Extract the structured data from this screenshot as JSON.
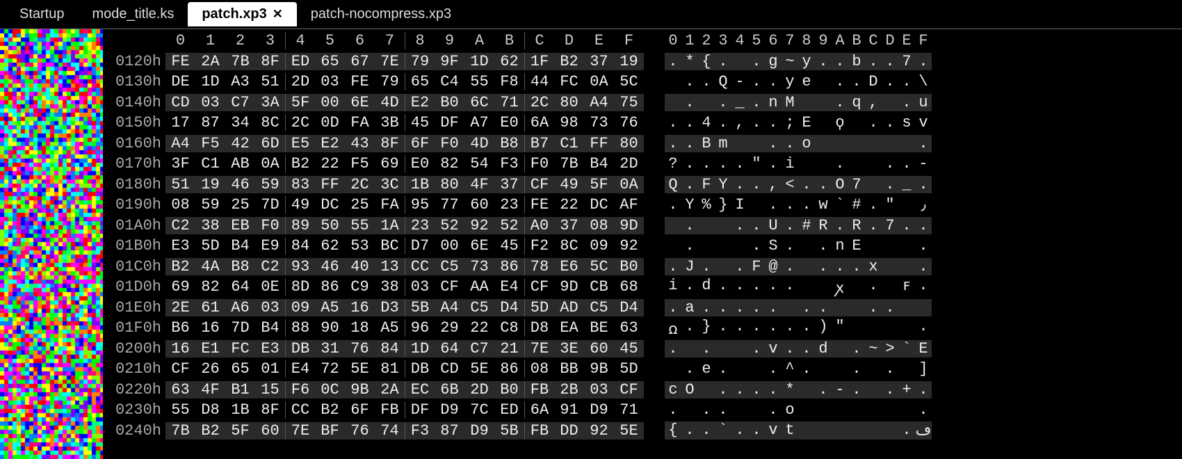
{
  "tabs": [
    {
      "label": "Startup",
      "active": false,
      "closable": false
    },
    {
      "label": "mode_title.ks",
      "active": false,
      "closable": false
    },
    {
      "label": "patch.xp3",
      "active": true,
      "closable": true
    },
    {
      "label": "patch-nocompress.xp3",
      "active": false,
      "closable": false
    }
  ],
  "hex_header": [
    "0",
    "1",
    "2",
    "3",
    "4",
    "5",
    "6",
    "7",
    "8",
    "9",
    "A",
    "B",
    "C",
    "D",
    "E",
    "F"
  ],
  "ascii_header": [
    "0",
    "1",
    "2",
    "3",
    "4",
    "5",
    "6",
    "7",
    "8",
    "9",
    "A",
    "B",
    "C",
    "D",
    "E",
    "F"
  ],
  "rows": [
    {
      "addr": "0120h",
      "hex": [
        "FE",
        "2A",
        "7B",
        "8F",
        "ED",
        "65",
        "67",
        "7E",
        "79",
        "9F",
        "1D",
        "62",
        "1F",
        "B2",
        "37",
        "19"
      ],
      "ascii": [
        ".",
        "*",
        "{",
        ".",
        " ",
        ".",
        "g",
        "~",
        "y",
        ".",
        ".",
        "b",
        ".",
        ".",
        "7",
        "."
      ]
    },
    {
      "addr": "0130h",
      "hex": [
        "DE",
        "1D",
        "A3",
        "51",
        "2D",
        "03",
        "FE",
        "79",
        "65",
        "C4",
        "55",
        "F8",
        "44",
        "FC",
        "0A",
        "5C"
      ],
      "ascii": [
        " ",
        ".",
        ".",
        "Q",
        "-",
        ".",
        ".",
        "y",
        "e",
        " ",
        ".",
        ".",
        "D",
        ".",
        ".",
        "\\"
      ]
    },
    {
      "addr": "0140h",
      "hex": [
        "CD",
        "03",
        "C7",
        "3A",
        "5F",
        "00",
        "6E",
        "4D",
        "E2",
        "B0",
        "6C",
        "71",
        "2C",
        "80",
        "A4",
        "75"
      ],
      "ascii": [
        " ",
        ".",
        " ",
        ".",
        "_",
        ".",
        "n",
        "M",
        " ",
        " ",
        ".",
        "q",
        ",",
        " ",
        ".",
        "u"
      ]
    },
    {
      "addr": "0150h",
      "hex": [
        "17",
        "87",
        "34",
        "8C",
        "2C",
        "0D",
        "FA",
        "3B",
        "45",
        "DF",
        "A7",
        "E0",
        "6A",
        "98",
        "73",
        "76"
      ],
      "ascii": [
        ".",
        ".",
        "4",
        ".",
        ",",
        ".",
        ".",
        ";",
        "E",
        " ",
        "ϙ",
        " ",
        ".",
        ".",
        "s",
        "v"
      ]
    },
    {
      "addr": "0160h",
      "hex": [
        "A4",
        "F5",
        "42",
        "6D",
        "E5",
        "E2",
        "43",
        "8F",
        "6F",
        "F0",
        "4D",
        "B8",
        "B7",
        "C1",
        "FF",
        "80"
      ],
      "ascii": [
        ".",
        ".",
        "B",
        "m",
        " ",
        " ",
        ".",
        ".",
        "o",
        " ",
        " ",
        " ",
        " ",
        " ",
        " ",
        "."
      ]
    },
    {
      "addr": "0170h",
      "hex": [
        "3F",
        "C1",
        "AB",
        "0A",
        "B2",
        "22",
        "F5",
        "69",
        "E0",
        "82",
        "54",
        "F3",
        "F0",
        "7B",
        "B4",
        "2D"
      ],
      "ascii": [
        "?",
        ".",
        ".",
        ".",
        ".",
        "\"",
        ".",
        "i",
        " ",
        " ",
        ".",
        " ",
        " ",
        ".",
        ".",
        "-"
      ]
    },
    {
      "addr": "0180h",
      "hex": [
        "51",
        "19",
        "46",
        "59",
        "83",
        "FF",
        "2C",
        "3C",
        "1B",
        "80",
        "4F",
        "37",
        "CF",
        "49",
        "5F",
        "0A"
      ],
      "ascii": [
        "Q",
        ".",
        "F",
        "Y",
        ".",
        ".",
        ",",
        "<",
        ".",
        ".",
        "O",
        "7",
        " ",
        ".",
        "_",
        "."
      ]
    },
    {
      "addr": "0190h",
      "hex": [
        "08",
        "59",
        "25",
        "7D",
        "49",
        "DC",
        "25",
        "FA",
        "95",
        "77",
        "60",
        "23",
        "FE",
        "22",
        "DC",
        "AF"
      ],
      "ascii": [
        ".",
        "Y",
        "%",
        "}",
        "I",
        " ",
        ".",
        ".",
        ".",
        "w",
        "`",
        "#",
        ".",
        "\"",
        " ",
        "٫"
      ]
    },
    {
      "addr": "01A0h",
      "hex": [
        "C2",
        "38",
        "EB",
        "F0",
        "89",
        "50",
        "55",
        "1A",
        "23",
        "52",
        "92",
        "52",
        "A0",
        "37",
        "08",
        "9D"
      ],
      "ascii": [
        " ",
        ".",
        " ",
        " ",
        ".",
        ".",
        "U",
        ".",
        "#",
        "R",
        ".",
        "R",
        ".",
        "7",
        ".",
        "."
      ]
    },
    {
      "addr": "01B0h",
      "hex": [
        "E3",
        "5D",
        "B4",
        "E9",
        "84",
        "62",
        "53",
        "BC",
        "D7",
        "00",
        "6E",
        "45",
        "F2",
        "8C",
        "09",
        "92"
      ],
      "ascii": [
        " ",
        ".",
        " ",
        " ",
        " ",
        ".",
        "S",
        ".",
        " ",
        ".",
        "n",
        "E",
        " ",
        " ",
        " ",
        "."
      ]
    },
    {
      "addr": "01C0h",
      "hex": [
        "B2",
        "4A",
        "B8",
        "C2",
        "93",
        "46",
        "40",
        "13",
        "CC",
        "C5",
        "73",
        "86",
        "78",
        "E6",
        "5C",
        "B0"
      ],
      "ascii": [
        ".",
        "J",
        ".",
        " ",
        ".",
        "F",
        "@",
        ".",
        " ",
        ".",
        ".",
        ".",
        "x",
        " ",
        " ",
        "."
      ]
    },
    {
      "addr": "01D0h",
      "hex": [
        "69",
        "82",
        "64",
        "0E",
        "8D",
        "86",
        "C9",
        "38",
        "03",
        "CF",
        "AA",
        "E4",
        "CF",
        "9D",
        "CB",
        "68"
      ],
      "ascii": [
        "i",
        ".",
        "d",
        ".",
        ".",
        ".",
        ".",
        ".",
        " ",
        " ",
        "ꭗ",
        " ",
        ".",
        " ",
        "ꜰ",
        "."
      ]
    },
    {
      "addr": "01E0h",
      "hex": [
        "2E",
        "61",
        "A6",
        "03",
        "09",
        "A5",
        "16",
        "D3",
        "5B",
        "A4",
        "C5",
        "D4",
        "5D",
        "AD",
        "C5",
        "D4"
      ],
      "ascii": [
        ".",
        "a",
        ".",
        ".",
        ".",
        ".",
        ".",
        " ",
        ".",
        ".",
        " ",
        " ",
        ".",
        ".",
        " ",
        " "
      ]
    },
    {
      "addr": "01F0h",
      "hex": [
        "B6",
        "16",
        "7D",
        "B4",
        "88",
        "90",
        "18",
        "A5",
        "96",
        "29",
        "22",
        "C8",
        "D8",
        "EA",
        "BE",
        "63"
      ],
      "ascii": [
        "ꭥ",
        ".",
        "}",
        ".",
        ".",
        ".",
        ".",
        ".",
        ".",
        ")",
        "\"",
        " ",
        " ",
        " ",
        " ",
        "."
      ]
    },
    {
      "addr": "0200h",
      "hex": [
        "16",
        "E1",
        "FC",
        "E3",
        "DB",
        "31",
        "76",
        "84",
        "1D",
        "64",
        "C7",
        "21",
        "7E",
        "3E",
        "60",
        "45"
      ],
      "ascii": [
        ".",
        " ",
        ".",
        " ",
        " ",
        ".",
        "v",
        ".",
        ".",
        "d",
        " ",
        ".",
        "~",
        ">",
        "`",
        "E"
      ]
    },
    {
      "addr": "0210h",
      "hex": [
        "CF",
        "26",
        "65",
        "01",
        "E4",
        "72",
        "5E",
        "81",
        "DB",
        "CD",
        "5E",
        "86",
        "08",
        "BB",
        "9B",
        "5D"
      ],
      "ascii": [
        " ",
        ".",
        "e",
        ".",
        " ",
        " ",
        ".",
        "^",
        ".",
        " ",
        " ",
        ".",
        " ",
        ".",
        " ",
        "]"
      ]
    },
    {
      "addr": "0220h",
      "hex": [
        "63",
        "4F",
        "B1",
        "15",
        "F6",
        "0C",
        "9B",
        "2A",
        "EC",
        "6B",
        "2D",
        "B0",
        "FB",
        "2B",
        "03",
        "CF"
      ],
      "ascii": [
        "c",
        "O",
        " ",
        ".",
        ".",
        ".",
        ".",
        "*",
        " ",
        ".",
        "-",
        ".",
        " ",
        ".",
        "+",
        "."
      ]
    },
    {
      "addr": "0230h",
      "hex": [
        "55",
        "D8",
        "1B",
        "8F",
        "CC",
        "B2",
        "6F",
        "FB",
        "DF",
        "D9",
        "7C",
        "ED",
        "6A",
        "91",
        "D9",
        "71"
      ],
      "ascii": [
        ".",
        " ",
        ".",
        ".",
        " ",
        " ",
        ".",
        "o",
        " ",
        " ",
        " ",
        " ",
        " ",
        " ",
        " ",
        "."
      ]
    },
    {
      "addr": "0240h",
      "hex": [
        "7B",
        "B2",
        "5F",
        "60",
        "7E",
        "BF",
        "76",
        "74",
        "F3",
        "87",
        "D9",
        "5B",
        "FB",
        "DD",
        "92",
        "5E"
      ],
      "ascii": [
        "{",
        ".",
        ".",
        "`",
        ".",
        ".",
        "v",
        "t",
        " ",
        " ",
        " ",
        " ",
        " ",
        " ",
        ".",
        "ڡ"
      ]
    }
  ],
  "minimap": {
    "colors": [
      "#ff0000",
      "#00ff00",
      "#0000ff",
      "#ffff00",
      "#ff00ff",
      "#00ffff",
      "#ff8000",
      "#8000ff",
      "#00ff80",
      "#ff0080",
      "#80ff00",
      "#0080ff"
    ]
  }
}
